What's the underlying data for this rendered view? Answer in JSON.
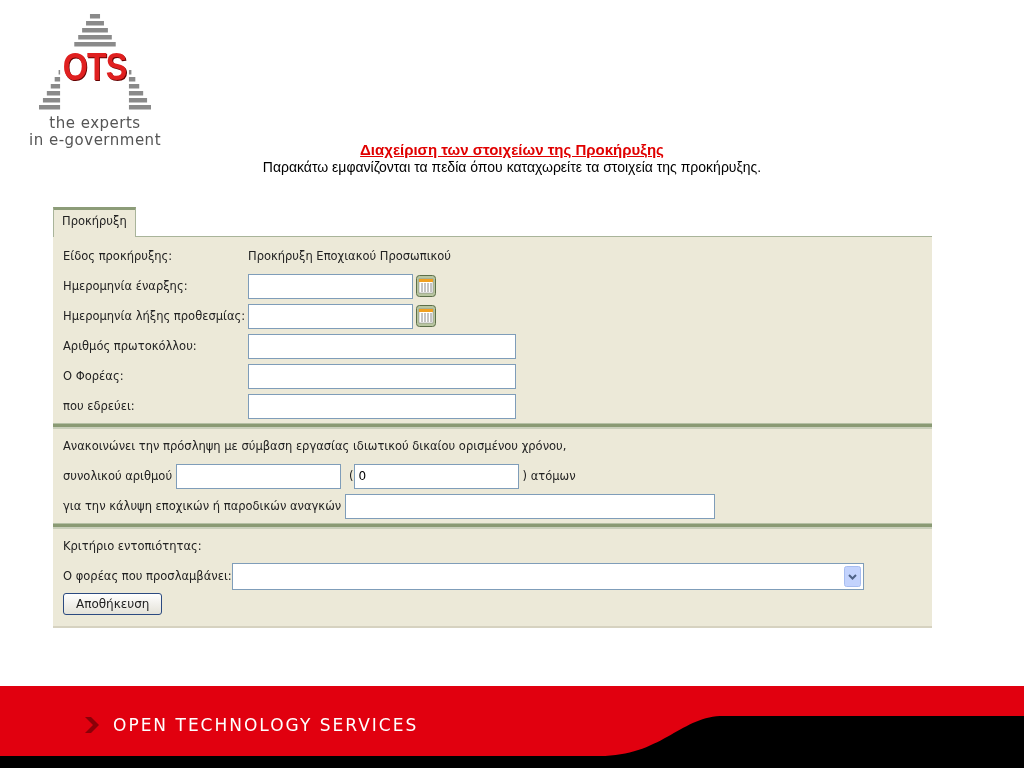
{
  "logo": {
    "mark": "OTS",
    "tagline": [
      "the experts",
      "in e-government"
    ]
  },
  "header": {
    "title": "Διαχείριση των στοιχείων της Προκήρυξης",
    "subtitle": "Παρακάτω εμφανίζονται τα πεδία όπου καταχωρείτε τα στοιχεία της προκήρυξης."
  },
  "tabs": [
    {
      "label": "Προκήρυξη",
      "selected": true
    }
  ],
  "details": [
    {
      "kind": "static",
      "label": "Είδος προκήρυξης:",
      "value": "Προκήρυξη Εποχιακού Προσωπικού"
    },
    {
      "kind": "date",
      "label": "Ημερομηνία έναρξης:"
    },
    {
      "kind": "date",
      "label": "Ημερομηνία λήξης προθεσμίας:"
    },
    {
      "kind": "text",
      "label": "Αριθμός πρωτοκόλλου:"
    },
    {
      "kind": "text",
      "label": "Ο Φορέας:"
    },
    {
      "kind": "text",
      "label": "που εδρεύει:"
    }
  ],
  "announcement": {
    "intro": "Ανακοινώνει την πρόσληψη με σύμβαση εργασίας ιδιωτικού δικαίου ορισμένου χρόνου,",
    "count_label": "συνολικού αριθμού",
    "open_paren": "(",
    "count_value": "0",
    "close_label": ") ατόμων",
    "needs_label": "για την κάλυψη εποχικών ή παροδικών αναγκών"
  },
  "locality": {
    "heading": "Κριτήριο εντοπιότητας:",
    "employer_label": "Ο φορέας που προσλαμβάνει:"
  },
  "buttons": [
    "Αποθήκευση"
  ],
  "footer": {
    "text": "OPEN TECHNOLOGY SERVICES"
  }
}
